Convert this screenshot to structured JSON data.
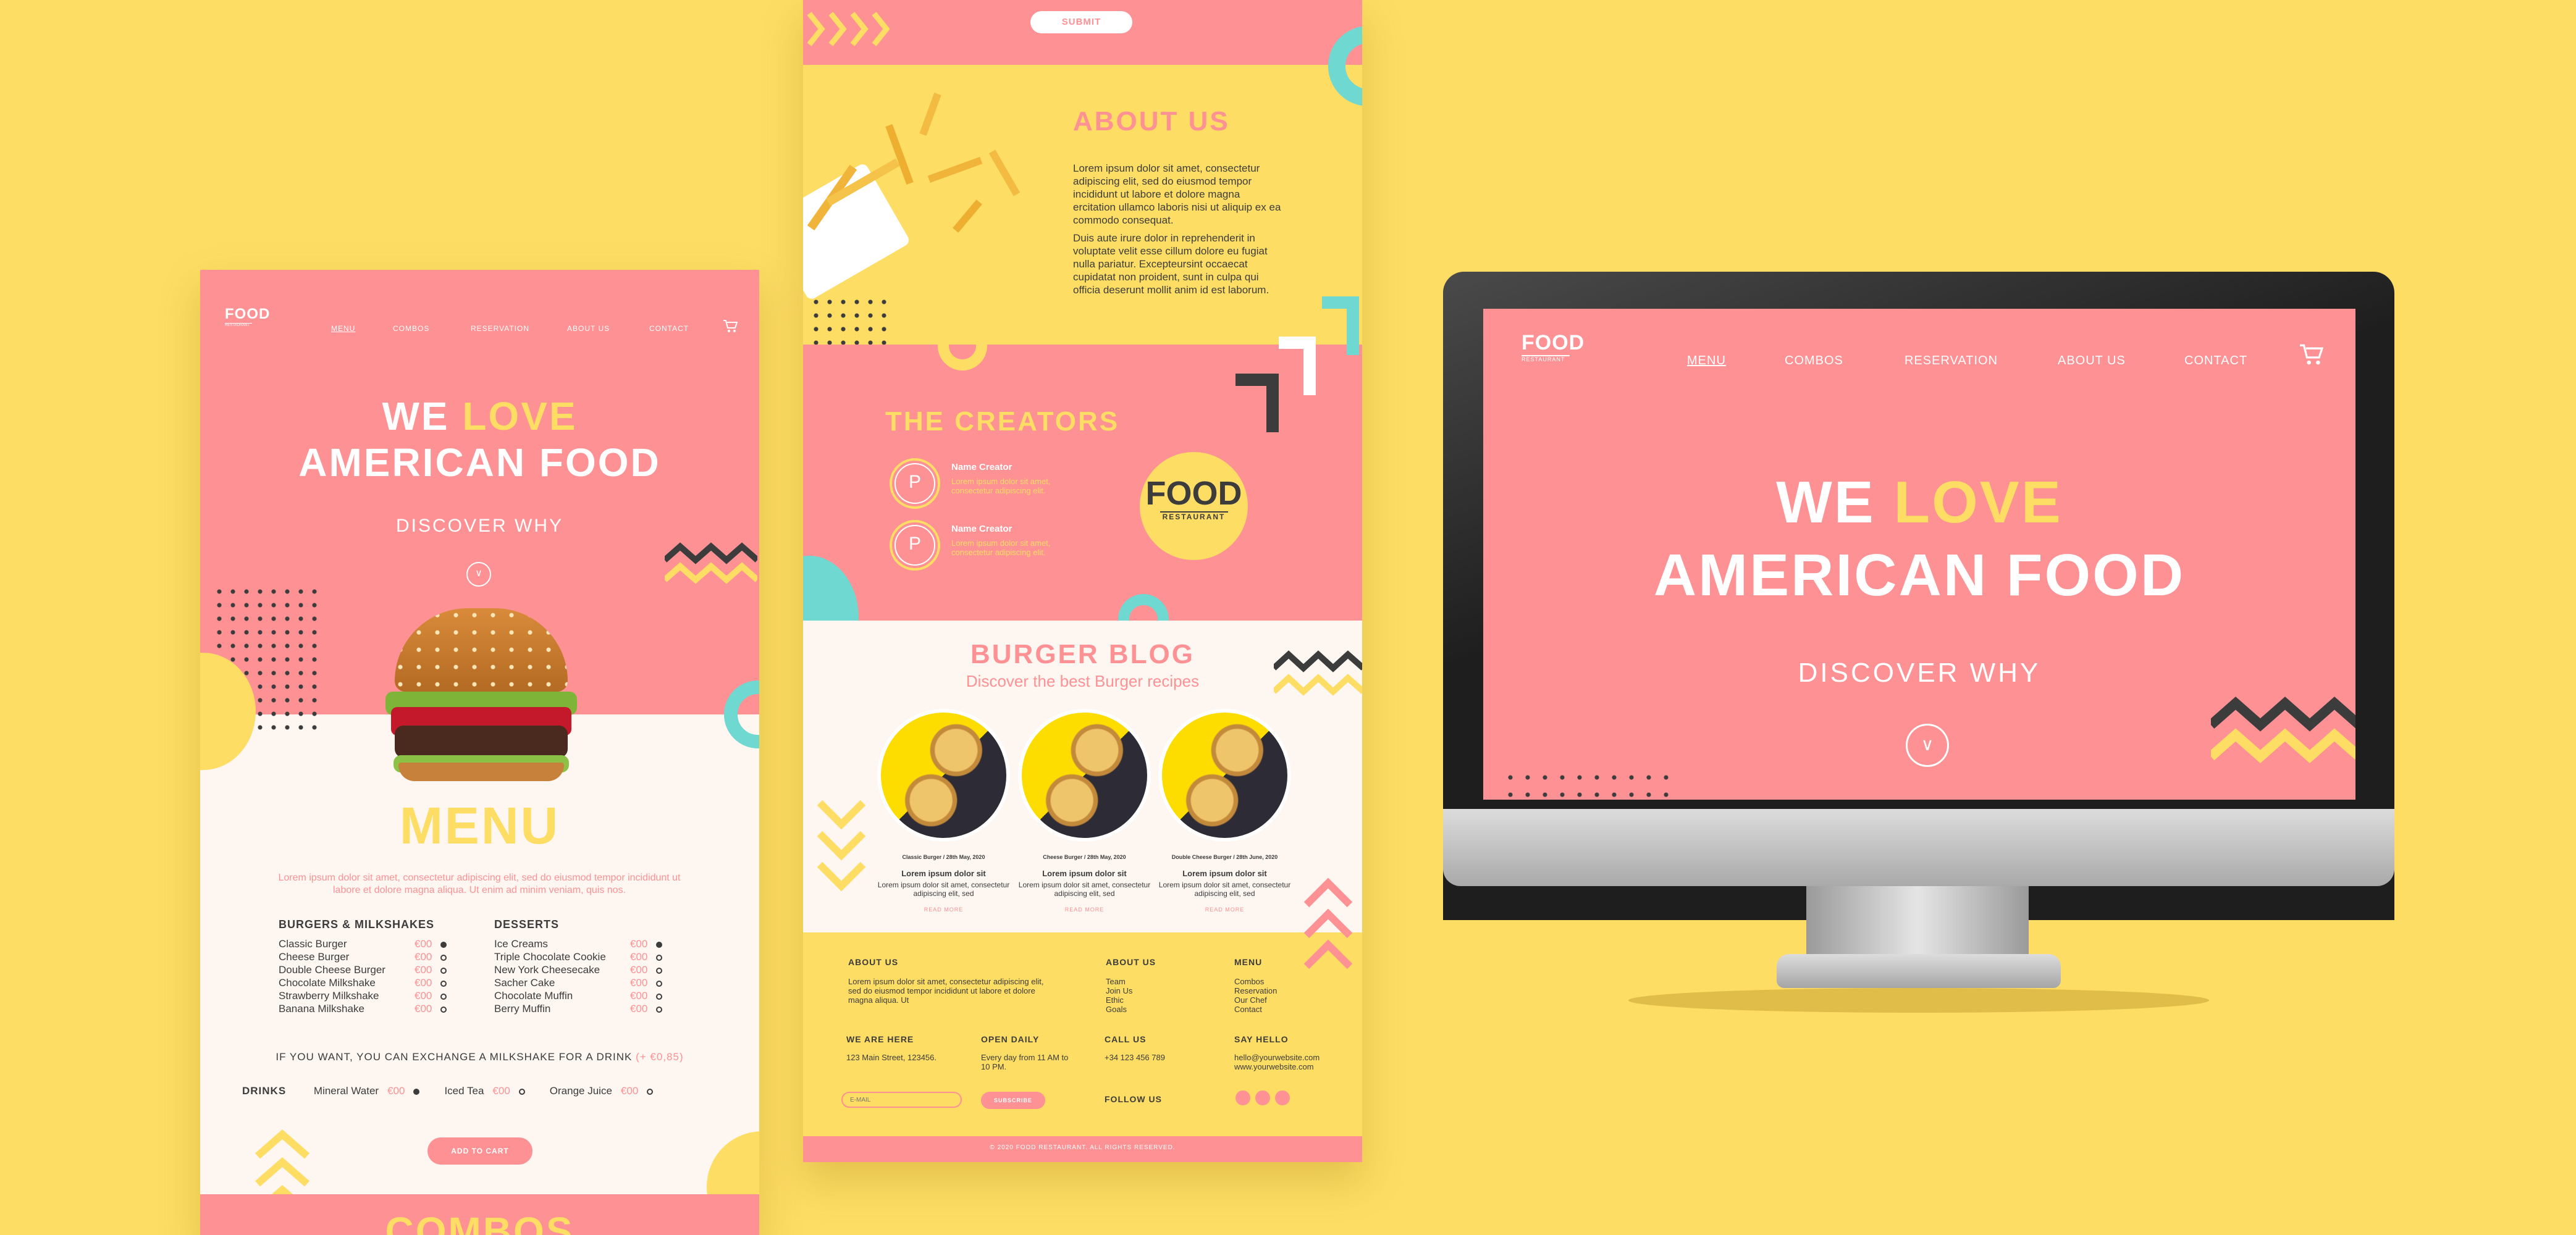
{
  "brand": {
    "logo_top": "FOOD",
    "logo_bottom": "RESTAURANT"
  },
  "nav": {
    "menu": "MENU",
    "combos": "COMBOS",
    "reservation": "RESERVATION",
    "about": "ABOUT US",
    "contact": "CONTACT"
  },
  "hero": {
    "we": "WE",
    "love": "LOVE",
    "american_food": "AMERICAN FOOD",
    "discover": "DISCOVER WHY"
  },
  "menu": {
    "title": "MENU",
    "intro": "Lorem ipsum dolor sit amet, consectetur adipiscing elit, sed do eiusmod tempor incididunt ut labore et dolore magna aliqua. Ut enim ad minim veniam, quis nos.",
    "burgers_title": "BURGERS & MILKSHAKES",
    "burgers": [
      {
        "name": "Classic Burger",
        "price": "€00"
      },
      {
        "name": "Cheese Burger",
        "price": "€00"
      },
      {
        "name": "Double Cheese Burger",
        "price": "€00"
      },
      {
        "name": "Chocolate Milkshake",
        "price": "€00"
      },
      {
        "name": "Strawberry Milkshake",
        "price": "€00"
      },
      {
        "name": "Banana Milkshake",
        "price": "€00"
      }
    ],
    "desserts_title": "DESSERTS",
    "desserts": [
      {
        "name": "Ice Creams",
        "price": "€00"
      },
      {
        "name": "Triple Chocolate Cookie",
        "price": "€00"
      },
      {
        "name": "New York Cheesecake",
        "price": "€00"
      },
      {
        "name": "Sacher Cake",
        "price": "€00"
      },
      {
        "name": "Chocolate Muffin",
        "price": "€00"
      },
      {
        "name": "Berry Muffin",
        "price": "€00"
      }
    ],
    "exchange_note": "IF YOU WANT, YOU CAN EXCHANGE A MILKSHAKE FOR A DRINK",
    "exchange_price": "(+ €0,85)",
    "drinks_title": "DRINKS",
    "drinks": [
      {
        "name": "Mineral Water",
        "price": "€00"
      },
      {
        "name": "Iced Tea",
        "price": "€00"
      },
      {
        "name": "Orange Juice",
        "price": "€00"
      }
    ],
    "add_to_cart": "ADD TO CART",
    "combos_peek": "COMBOS"
  },
  "middle": {
    "submit": "SUBMIT",
    "about_title": "ABOUT US",
    "about_p1": "Lorem ipsum dolor sit amet, consectetur adipiscing elit, sed do eiusmod tempor incididunt ut labore et dolore magna ercitation ullamco laboris nisi ut aliquip ex ea commodo consequat.",
    "about_p2": "Duis aute irure dolor in reprehenderit in voluptate velit esse cillum dolore eu fugiat nulla pariatur. Excepteursint occaecat cupidatat non proident, sunt in culpa qui officia deserunt mollit anim id est laborum.",
    "creators_title": "THE CREATORS",
    "creators": [
      {
        "initial": "P",
        "name": "Name Creator",
        "text": "Lorem ipsum dolor sit amet, consectetur adipiscing elit."
      },
      {
        "initial": "P",
        "name": "Name Creator",
        "text": "Lorem ipsum dolor sit amet, consectetur adipiscing elit."
      }
    ],
    "blog_title": "BURGER BLOG",
    "blog_sub": "Discover the best Burger recipes",
    "posts": [
      {
        "meta": "Classic Burger / 28th May, 2020",
        "title": "Lorem ipsum dolor sit",
        "text": "Lorem ipsum dolor sit amet, consectetur adipiscing elit, sed",
        "more": "READ MORE"
      },
      {
        "meta": "Cheese Burger / 28th May, 2020",
        "title": "Lorem ipsum dolor sit",
        "text": "Lorem ipsum dolor sit amet, consectetur adipiscing elit, sed",
        "more": "READ MORE"
      },
      {
        "meta": "Double Cheese Burger / 28th June, 2020",
        "title": "Lorem ipsum dolor sit",
        "text": "Lorem ipsum dolor sit amet, consectetur adipiscing elit, sed",
        "more": "READ MORE"
      }
    ],
    "footer": {
      "about_h": "ABOUT US",
      "about_t": "Lorem ipsum dolor sit amet, consectetur adipiscing elit, sed do eiusmod tempor incididunt ut labore et dolore magna aliqua. Ut",
      "about2_h": "ABOUT US",
      "about2_items": [
        "Team",
        "Join Us",
        "Ethic",
        "Goals"
      ],
      "menu_h": "MENU",
      "menu_items": [
        "Combos",
        "Reservation",
        "Our Chef",
        "Contact"
      ],
      "where_h": "WE ARE HERE",
      "where_t": "123 Main Street, 123456.",
      "open_h": "OPEN DAILY",
      "open_t": "Every day from 11 AM to 10 PM.",
      "call_h": "CALL US",
      "call_t": "+34 123 456 789",
      "hello_h": "SAY HELLO",
      "hello_t1": "hello@yourwebsite.com",
      "hello_t2": "www.yourwebsite.com",
      "email_placeholder": "E-MAIL",
      "subscribe": "SUBSCRIBE",
      "follow": "FOLLOW US",
      "copyright": "© 2020 FOOD RESTAURANT. ALL RIGHTS RESERVED."
    }
  },
  "creator_badge": {
    "top": "FOOD",
    "bottom": "RESTAURANT"
  }
}
